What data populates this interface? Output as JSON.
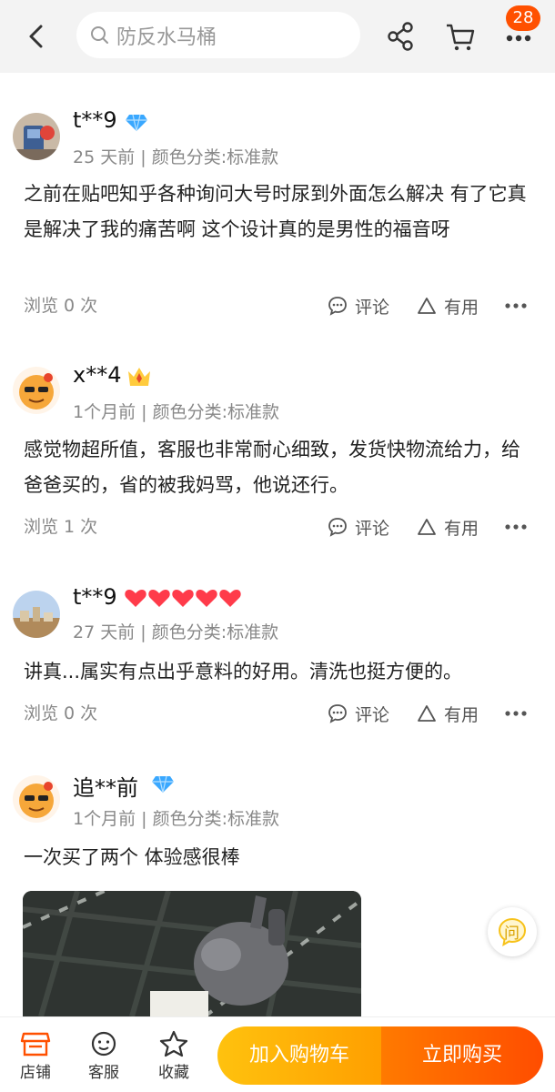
{
  "header": {
    "search_placeholder": "防反水马桶",
    "cart_badge": "28"
  },
  "reviews": [
    {
      "username": "t**9",
      "tag": "diamond-icon",
      "meta": "25 天前 | 颜色分类:标准款",
      "content": "之前在贴吧知乎各种询问大号时尿到外面怎么解决 有了它真是解决了我的痛苦啊 这个设计真的是男性的福音呀",
      "views": "浏览 0 次"
    },
    {
      "username": "x**4",
      "tag": "crown-icon",
      "meta": "1个月前 | 颜色分类:标准款",
      "content": "感觉物超所值，客服也非常耐心细致，发货快物流给力，给爸爸买的，省的被我妈骂，他说还行。",
      "views": "浏览 1 次"
    },
    {
      "username": "t**9",
      "tag": "hearts-icon",
      "hearts": 5,
      "meta": "27 天前 | 颜色分类:标准款",
      "content": "讲真...属实有点出乎意料的好用。清洗也挺方便的。",
      "views": "浏览 0 次"
    },
    {
      "username": "追**前",
      "tag": "diamond-icon",
      "meta": "1个月前 | 颜色分类:标准款",
      "content": "一次买了两个 体验感很棒"
    }
  ],
  "actions": {
    "comment_label": "评论",
    "useful_label": "有用"
  },
  "fab": {
    "ask_label": "问"
  },
  "bottom_bar": {
    "store_label": "店铺",
    "service_label": "客服",
    "favorite_label": "收藏",
    "add_to_cart_label": "加入购物车",
    "buy_now_label": "立即购买"
  },
  "colors": {
    "accent": "#ff5000",
    "cart_button": "#ffb000",
    "buy_button": "#ff5a00",
    "diamond": "#3aa8ff",
    "heart": "#ff3b4a"
  }
}
